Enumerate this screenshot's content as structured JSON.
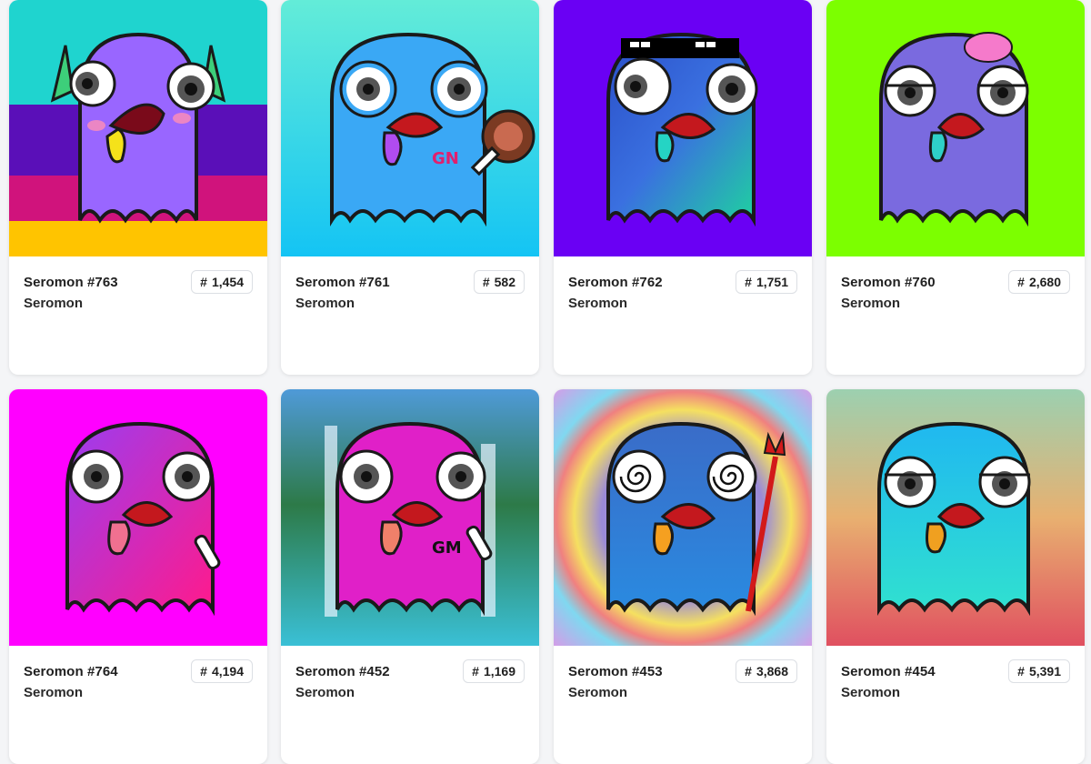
{
  "cards": [
    {
      "name": "Seromon #763",
      "collection": "Seromon",
      "rank_symbol": "#",
      "rank": "1,454",
      "bg": "stripes",
      "body": "#9966ff",
      "tongue": "#f5e21a"
    },
    {
      "name": "Seromon #761",
      "collection": "Seromon",
      "rank_symbol": "#",
      "rank": "582",
      "bg": "#28d6ee",
      "body": "#3aa8f5",
      "tongue": "#b04cf0",
      "text": "GN"
    },
    {
      "name": "Seromon #762",
      "collection": "Seromon",
      "rank_symbol": "#",
      "rank": "1,751",
      "bg": "#6a00f4",
      "body": "#2f70d6",
      "tongue": "#25d4c4"
    },
    {
      "name": "Seromon #760",
      "collection": "Seromon",
      "rank_symbol": "#",
      "rank": "2,680",
      "bg": "#7cff00",
      "body": "#7a6adf",
      "tongue": "#2ed0c8"
    },
    {
      "name": "Seromon #764",
      "collection": "Seromon",
      "rank_symbol": "#",
      "rank": "4,194",
      "bg": "#ff00ff",
      "body": "#c733e8",
      "tongue": "#f07090"
    },
    {
      "name": "Seromon #452",
      "collection": "Seromon",
      "rank_symbol": "#",
      "rank": "1,169",
      "bg": "#2d8f5a",
      "body": "#e020c8",
      "tongue": "#f0806a",
      "text": "GM"
    },
    {
      "name": "Seromon #453",
      "collection": "Seromon",
      "rank_symbol": "#",
      "rank": "3,868",
      "bg": "#c8a0e0",
      "body": "#3a6cc8",
      "tongue": "#f5a020"
    },
    {
      "name": "Seromon #454",
      "collection": "Seromon",
      "rank_symbol": "#",
      "rank": "5,391",
      "bg": "#e8a070",
      "body": "#20b8f0",
      "tongue": "#f0a020"
    }
  ]
}
